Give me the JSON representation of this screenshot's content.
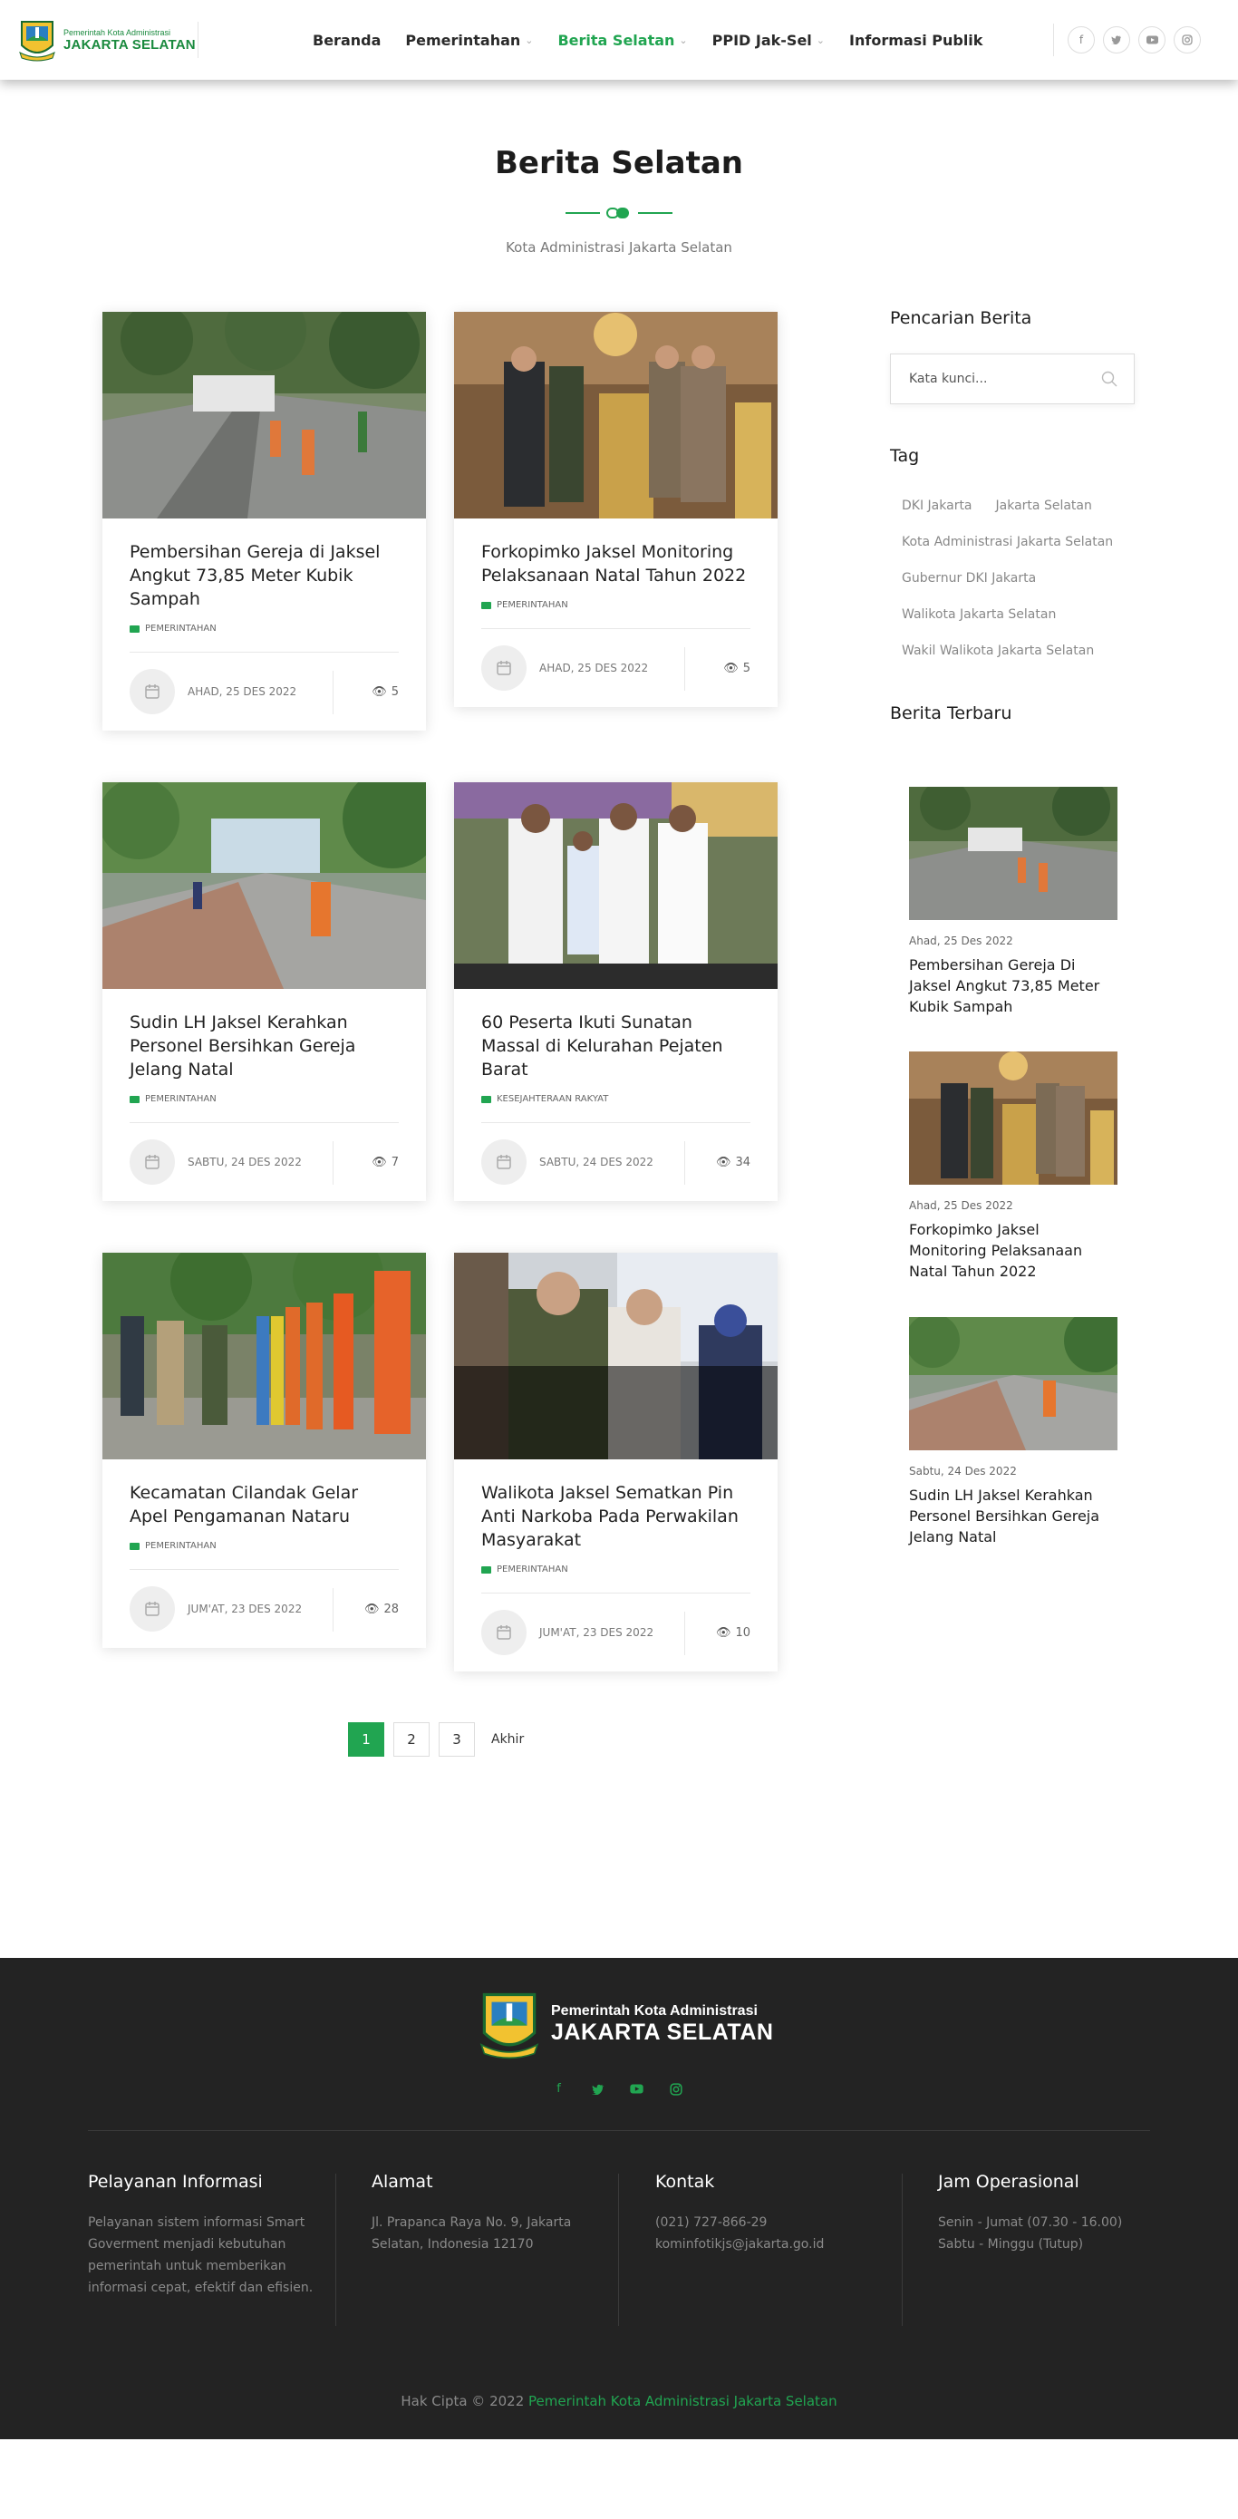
{
  "header": {
    "logo_small": "Pemerintah Kota Administrasi",
    "logo_big": "JAKARTA SELATAN",
    "nav": [
      {
        "label": "Beranda"
      },
      {
        "label": "Pemerintahan"
      },
      {
        "label": "Berita Selatan"
      },
      {
        "label": "PPID Jak-Sel"
      },
      {
        "label": "Informasi Publik"
      }
    ],
    "socials": [
      "facebook-icon",
      "twitter-icon",
      "youtube-icon",
      "instagram-icon"
    ]
  },
  "page": {
    "title": "Berita Selatan",
    "subtitle": "Kota Administrasi Jakarta Selatan"
  },
  "articles": [
    {
      "title": "Pembersihan Gereja di Jaksel Angkut 73,85 Meter Kubik Sampah",
      "category": "PEMERINTAHAN",
      "date": "AHAD, 25 DES 2022",
      "views": "5"
    },
    {
      "title": "Forkopimko Jaksel Monitoring Pelaksanaan Natal Tahun 2022",
      "category": "PEMERINTAHAN",
      "date": "AHAD, 25 DES 2022",
      "views": "5"
    },
    {
      "title": "Sudin LH Jaksel Kerahkan Personel Bersihkan Gereja Jelang Natal",
      "category": "PEMERINTAHAN",
      "date": "SABTU, 24 DES 2022",
      "views": "7"
    },
    {
      "title": "60 Peserta Ikuti Sunatan Massal di Kelurahan Pejaten Barat",
      "category": "KESEJAHTERAAN RAKYAT",
      "date": "SABTU, 24 DES 2022",
      "views": "34"
    },
    {
      "title": "Kecamatan Cilandak Gelar Apel Pengamanan Nataru",
      "category": "PEMERINTAHAN",
      "date": "JUM'AT, 23 DES 2022",
      "views": "28"
    },
    {
      "title": "Walikota Jaksel Sematkan Pin Anti Narkoba Pada Perwakilan Masyarakat",
      "category": "PEMERINTAHAN",
      "date": "JUM'AT, 23 DES 2022",
      "views": "10"
    }
  ],
  "pagination": {
    "pages": [
      "1",
      "2",
      "3"
    ],
    "last": "Akhir",
    "current": "1"
  },
  "sidebar": {
    "search_heading": "Pencarian Berita",
    "search_placeholder": "Kata kunci...",
    "tag_heading": "Tag",
    "tags": [
      "DKI Jakarta",
      "Jakarta Selatan",
      "Kota Administrasi Jakarta Selatan",
      "Gubernur DKI Jakarta",
      "Walikota Jakarta Selatan",
      "Wakil Walikota Jakarta Selatan"
    ],
    "latest_heading": "Berita Terbaru",
    "latest": [
      {
        "date": "Ahad, 25 Des 2022",
        "title": "Pembersihan Gereja Di Jaksel Angkut 73,85 Meter Kubik Sampah"
      },
      {
        "date": "Ahad, 25 Des 2022",
        "title": "Forkopimko Jaksel Monitoring Pelaksanaan Natal Tahun 2022"
      },
      {
        "date": "Sabtu, 24 Des 2022",
        "title": "Sudin LH Jaksel Kerahkan Personel Bersihkan Gereja Jelang Natal"
      }
    ]
  },
  "footer": {
    "logo_small": "Pemerintah Kota Administrasi",
    "logo_big": "JAKARTA SELATAN",
    "columns": [
      {
        "heading": "Pelayanan Informasi",
        "text": "Pelayanan sistem informasi Smart Goverment menjadi kebutuhan pemerintah untuk memberikan informasi cepat, efektif dan efisien."
      },
      {
        "heading": "Alamat",
        "text": "Jl. Prapanca Raya No. 9, Jakarta Selatan, Indonesia 12170"
      },
      {
        "heading": "Kontak",
        "text": "(021) 727-866-29 kominfotikjs@jakarta.go.id"
      },
      {
        "heading": "Jam Operasional",
        "text": "Senin - Jumat (07.30 - 16.00) Sabtu - Minggu (Tutup)"
      }
    ],
    "copyright_prefix": "Hak Cipta © 2022",
    "copyright_link": "Pemerintah Kota Administrasi Jakarta Selatan"
  },
  "colors": {
    "accent": "#21a551",
    "footer_bg": "#232323"
  }
}
